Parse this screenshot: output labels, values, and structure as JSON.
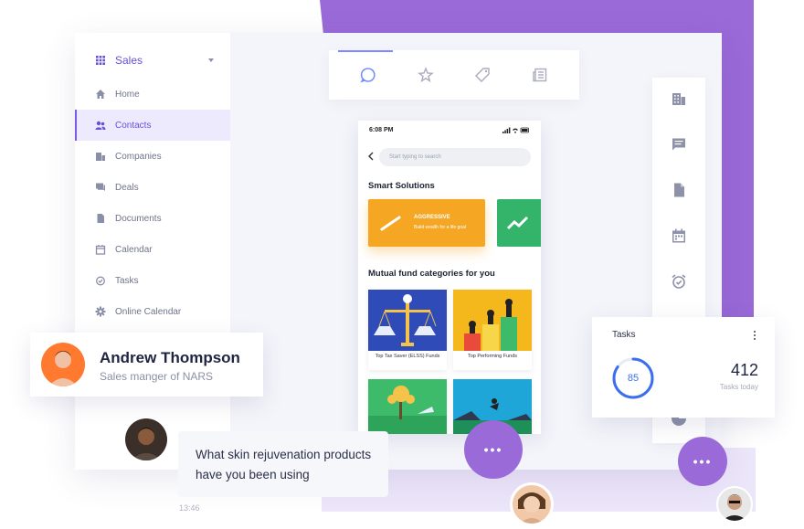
{
  "sidebar": {
    "header": "Sales",
    "items": [
      {
        "label": "Home",
        "icon": "home-icon"
      },
      {
        "label": "Contacts",
        "icon": "contacts-icon",
        "active": true
      },
      {
        "label": "Companies",
        "icon": "companies-icon"
      },
      {
        "label": "Deals",
        "icon": "deals-icon"
      },
      {
        "label": "Documents",
        "icon": "documents-icon"
      },
      {
        "label": "Calendar",
        "icon": "calendar-icon"
      },
      {
        "label": "Tasks",
        "icon": "tasks-icon"
      },
      {
        "label": "Online Calendar",
        "icon": "gear-icon"
      }
    ]
  },
  "tabs": [
    {
      "icon": "chat-icon",
      "active": true
    },
    {
      "icon": "star-icon"
    },
    {
      "icon": "tag-icon"
    },
    {
      "icon": "news-icon"
    }
  ],
  "rail": [
    "building-icon",
    "message-icon",
    "document-icon",
    "calendar-icon",
    "alarm-icon",
    "pie-chart-icon"
  ],
  "phone": {
    "time": "6:08 PM",
    "search_placeholder": "Start typing to search",
    "smart_heading": "Smart Solutions",
    "solution": {
      "title": "AGGRESSIVE",
      "subtitle": "Build wealth for a life goal"
    },
    "mf_heading": "Mutual fund categories for you",
    "funds": [
      {
        "caption": "Top Tax Saver (ELSS) Funds"
      },
      {
        "caption": "Top Performing Funds"
      }
    ]
  },
  "person": {
    "name": "Andrew Thompson",
    "role": "Sales manger of NARS"
  },
  "chat": {
    "message": "What skin rejuvenation products have you been using",
    "time": "13:46"
  },
  "tasks_widget": {
    "title": "Tasks",
    "progress": 85,
    "progress_label": "85",
    "count": "412",
    "count_label": "Tasks today"
  },
  "colors": {
    "accent": "#9a6ad8",
    "primary": "#6a4fd8",
    "progress": "#3c6ef0",
    "orange": "#f5a623",
    "green": "#34b36b"
  }
}
